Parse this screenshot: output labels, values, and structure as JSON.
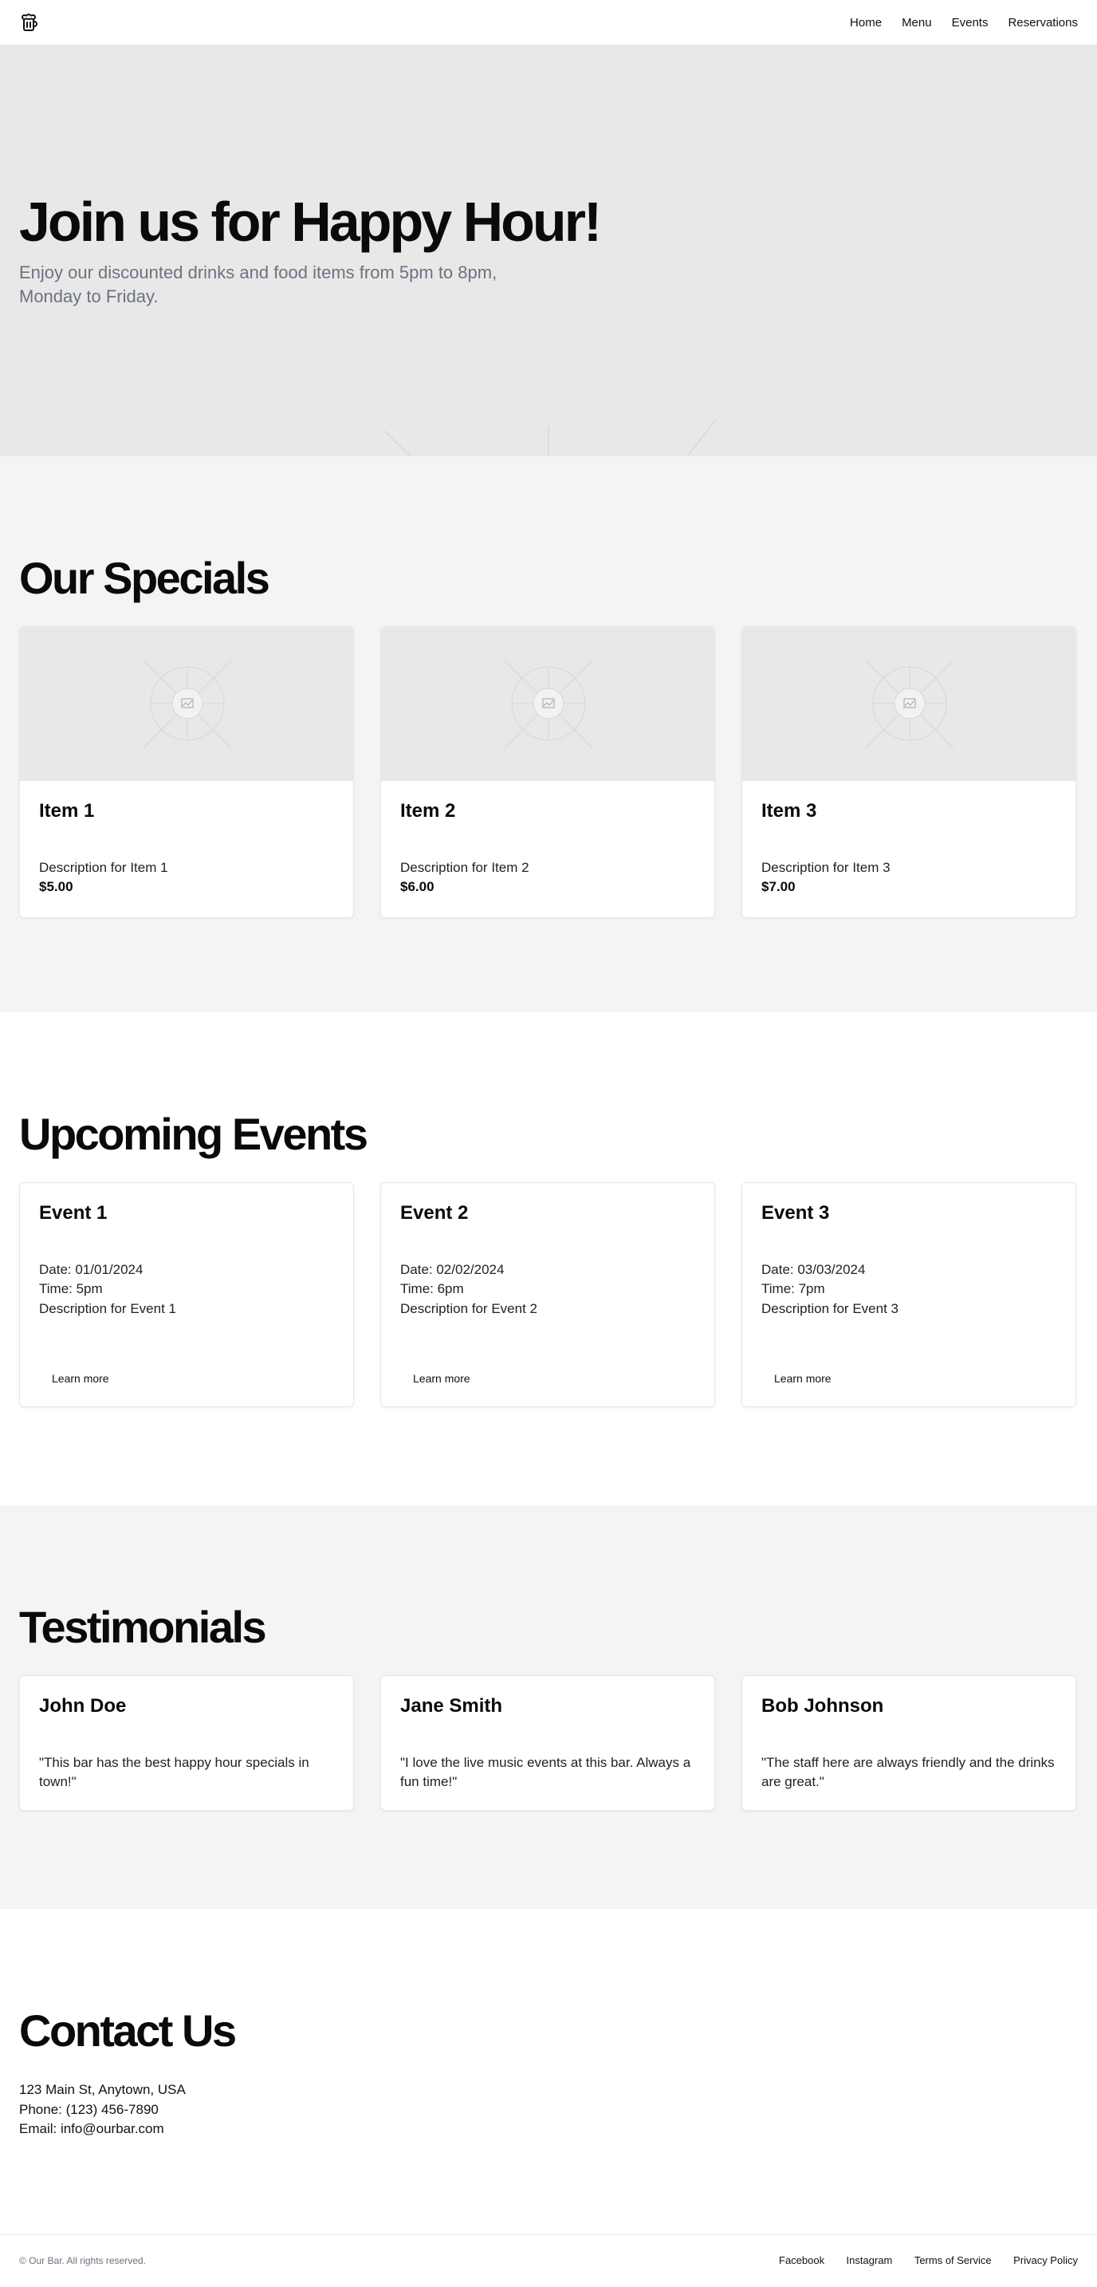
{
  "header": {
    "logo_icon": "beer-mug-icon",
    "nav": [
      {
        "label": "Home"
      },
      {
        "label": "Menu"
      },
      {
        "label": "Events"
      },
      {
        "label": "Reservations"
      }
    ]
  },
  "hero": {
    "title": "Join us for Happy Hour!",
    "subtitle": "Enjoy our discounted drinks and food items from 5pm to 8pm, Monday to Friday."
  },
  "specials": {
    "title": "Our Specials",
    "items": [
      {
        "name": "Item 1",
        "description": "Description for Item 1",
        "price": "$5.00",
        "image_icon": "image-placeholder-icon"
      },
      {
        "name": "Item 2",
        "description": "Description for Item 2",
        "price": "$6.00",
        "image_icon": "image-placeholder-icon"
      },
      {
        "name": "Item 3",
        "description": "Description for Item 3",
        "price": "$7.00",
        "image_icon": "image-placeholder-icon"
      }
    ]
  },
  "events": {
    "title": "Upcoming Events",
    "items": [
      {
        "name": "Event 1",
        "date": "Date: 01/01/2024",
        "time": "Time: 5pm",
        "description": "Description for Event 1",
        "button": "Learn more"
      },
      {
        "name": "Event 2",
        "date": "Date: 02/02/2024",
        "time": "Time: 6pm",
        "description": "Description for Event 2",
        "button": "Learn more"
      },
      {
        "name": "Event 3",
        "date": "Date: 03/03/2024",
        "time": "Time: 7pm",
        "description": "Description for Event 3",
        "button": "Learn more"
      }
    ]
  },
  "testimonials": {
    "title": "Testimonials",
    "items": [
      {
        "name": "John Doe",
        "quote": "\"This bar has the best happy hour specials in town!\""
      },
      {
        "name": "Jane Smith",
        "quote": "\"I love the live music events at this bar. Always a fun time!\""
      },
      {
        "name": "Bob Johnson",
        "quote": "\"The staff here are always friendly and the drinks are great.\""
      }
    ]
  },
  "contact": {
    "title": "Contact Us",
    "address": "123 Main St, Anytown, USA",
    "phone": "Phone: (123) 456-7890",
    "email": "Email: info@ourbar.com"
  },
  "footer": {
    "copyright": "© Our Bar. All rights reserved.",
    "links": [
      {
        "label": "Facebook"
      },
      {
        "label": "Instagram"
      },
      {
        "label": "Terms of Service"
      },
      {
        "label": "Privacy Policy"
      }
    ]
  }
}
